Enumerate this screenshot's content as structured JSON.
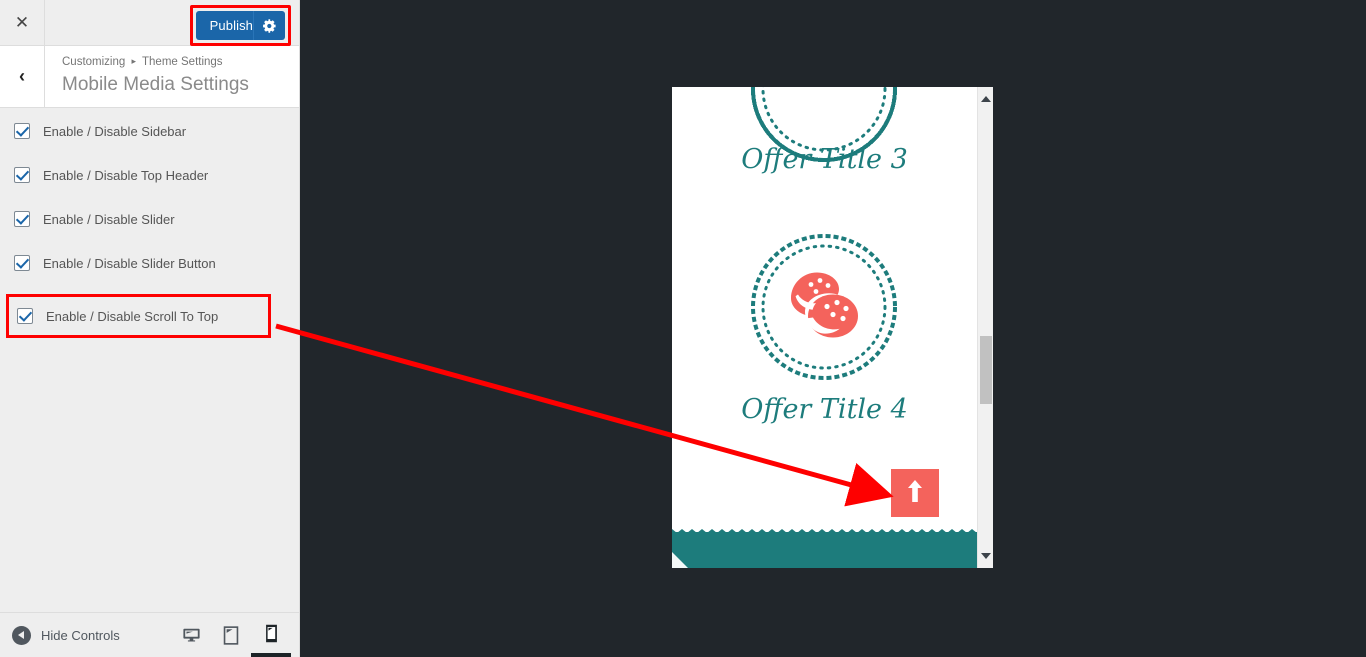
{
  "app": {
    "close_icon": "close-icon",
    "back_icon": "chevron-left-icon"
  },
  "toolbar": {
    "publish_label": "Publish",
    "publish_gear_icon": "gear-icon",
    "publish_bg": "#1b66a9",
    "highlight_color": "#fe0000"
  },
  "header": {
    "breadcrumb_root": "Customizing",
    "breadcrumb_sep": "▸",
    "breadcrumb_section": "Theme Settings",
    "title": "Mobile Media Settings"
  },
  "controls": [
    {
      "label": "Enable / Disable Sidebar",
      "checked": true,
      "highlighted": false
    },
    {
      "label": "Enable / Disable Top Header",
      "checked": true,
      "highlighted": false
    },
    {
      "label": "Enable / Disable Slider",
      "checked": true,
      "highlighted": false
    },
    {
      "label": "Enable / Disable Slider Button",
      "checked": true,
      "highlighted": false
    },
    {
      "label": "Enable / Disable Scroll To Top",
      "checked": true,
      "highlighted": true
    }
  ],
  "footer": {
    "hide_controls_label": "Hide Controls",
    "hide_controls_icon": "collapse-left-icon",
    "devices": [
      {
        "name": "desktop",
        "icon": "desktop-icon",
        "active": false
      },
      {
        "name": "tablet",
        "icon": "tablet-icon",
        "active": false
      },
      {
        "name": "mobile",
        "icon": "mobile-icon",
        "active": true
      }
    ]
  },
  "preview": {
    "theme_teal": "#1d7c7c",
    "accent_coral": "#f4635c",
    "offer_title_3": "Offer Title 3",
    "offer_title_4": "Offer Title 4",
    "cookie_icon": "cookies-icon",
    "scroll_top_icon": "arrow-up-icon",
    "scrollbar_up_icon": "caret-up-icon",
    "scrollbar_down_icon": "caret-down-icon"
  },
  "annotation": {
    "arrow_color": "#fe0000",
    "from": "enable-disable-scroll-to-top-row",
    "to": "scroll-to-top-button"
  }
}
